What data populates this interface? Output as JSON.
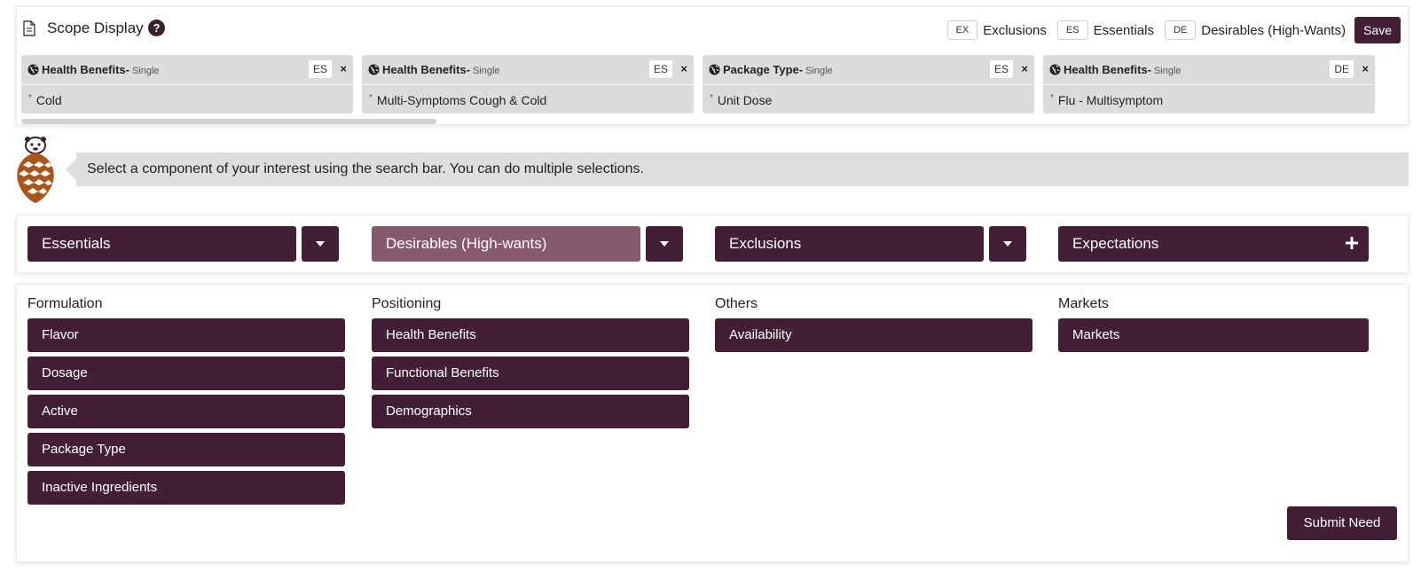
{
  "scope": {
    "title": "Scope Display",
    "help_icon": "question-circle-icon",
    "legend": [
      {
        "code": "EX",
        "label": "Exclusions"
      },
      {
        "code": "ES",
        "label": "Essentials"
      },
      {
        "code": "DE",
        "label": "Desirables (High-Wants)"
      }
    ],
    "save_label": "Save",
    "chips": [
      {
        "title": "Health Benefits-",
        "subtitle": "Single",
        "badge": "ES",
        "close": "×",
        "bullet": "*",
        "value": "Cold"
      },
      {
        "title": "Health Benefits-",
        "subtitle": "Single",
        "badge": "ES",
        "close": "×",
        "bullet": "*",
        "value": "Multi-Symptoms Cough & Cold"
      },
      {
        "title": "Package Type-",
        "subtitle": "Single",
        "badge": "ES",
        "close": "×",
        "bullet": "*",
        "value": "Unit Dose"
      },
      {
        "title": "Health Benefits-",
        "subtitle": "Single",
        "badge": "DE",
        "close": "×",
        "bullet": "*",
        "value": "Flu - Multisymptom"
      }
    ]
  },
  "hint": {
    "text": "Select a component of your interest using the search bar. You can do multiple selections."
  },
  "categories": [
    {
      "label": "Essentials",
      "control": "dropdown",
      "active": false
    },
    {
      "label": "Desirables (High-wants)",
      "control": "dropdown",
      "active": true
    },
    {
      "label": "Exclusions",
      "control": "dropdown",
      "active": false
    },
    {
      "label": "Expectations",
      "control": "plus",
      "active": false
    }
  ],
  "groups": [
    {
      "title": "Formulation",
      "items": [
        "Flavor",
        "Dosage",
        "Active",
        "Package Type",
        "Inactive Ingredients"
      ]
    },
    {
      "title": "Positioning",
      "items": [
        "Health Benefits",
        "Functional Benefits",
        "Demographics"
      ]
    },
    {
      "title": "Others",
      "items": [
        "Availability"
      ]
    },
    {
      "title": "Markets",
      "items": [
        "Markets"
      ]
    }
  ],
  "submit_label": "Submit Need",
  "colors": {
    "primary": "#421f34",
    "active": "#86596d",
    "chip_bg": "#dcdcdc",
    "hint_bg": "#dedede"
  }
}
